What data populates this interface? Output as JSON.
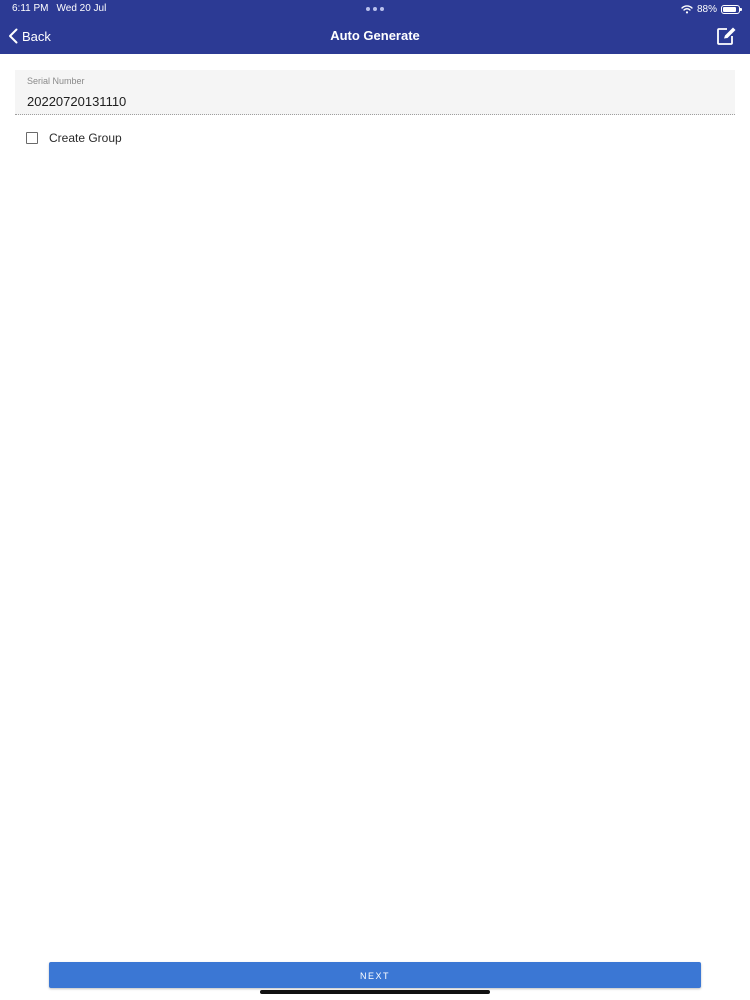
{
  "status_bar": {
    "time": "6:11 PM",
    "date": "Wed 20 Jul",
    "battery": "88%",
    "battery_level": 0.88,
    "icons": [
      "wifi-icon",
      "battery-icon"
    ]
  },
  "nav": {
    "back_label": "Back",
    "title": "Auto Generate",
    "icons": [
      "chevron-left-icon",
      "edit-icon"
    ]
  },
  "serial": {
    "label": "Serial Number",
    "value": "20220720131110"
  },
  "create_group": {
    "label": "Create Group",
    "checked": false
  },
  "footer": {
    "next_label": "NEXT"
  },
  "colors": {
    "nav_background": "#2c3a94",
    "button_background": "#3b77d4",
    "field_background": "#f5f5f5"
  }
}
